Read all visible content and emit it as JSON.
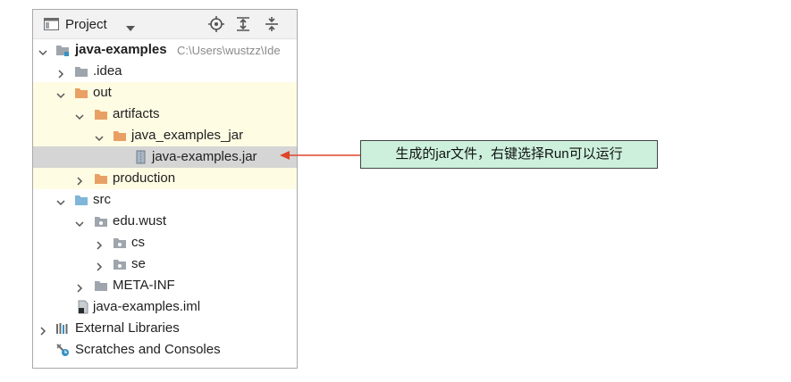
{
  "panel": {
    "title": "Project",
    "tools": [
      "locate-icon",
      "expand-all-icon",
      "collapse-all-icon"
    ]
  },
  "tree": {
    "root_label": "java-examples",
    "root_path": "C:\\Users\\wustzz\\Ide",
    "idea": ".idea",
    "out": "out",
    "artifacts": "artifacts",
    "java_examples_jar": "java_examples_jar",
    "jar_file": "java-examples.jar",
    "production": "production",
    "src": "src",
    "edu_wust": "edu.wust",
    "cs": "cs",
    "se": "se",
    "meta_inf": "META-INF",
    "iml": "java-examples.iml",
    "external_libraries": "External Libraries",
    "scratches": "Scratches and Consoles"
  },
  "annotation": {
    "text": "生成的jar文件，右键选择Run可以运行",
    "arrow_color": "#e0452a",
    "box_color": "#ccf0dc"
  },
  "colors": {
    "out_highlight": "#fefce3",
    "selection": "#d5d5d5",
    "folder_orange": "#e8a064",
    "folder_gray": "#9ea5ad",
    "folder_blue": "#7fb6d9"
  }
}
